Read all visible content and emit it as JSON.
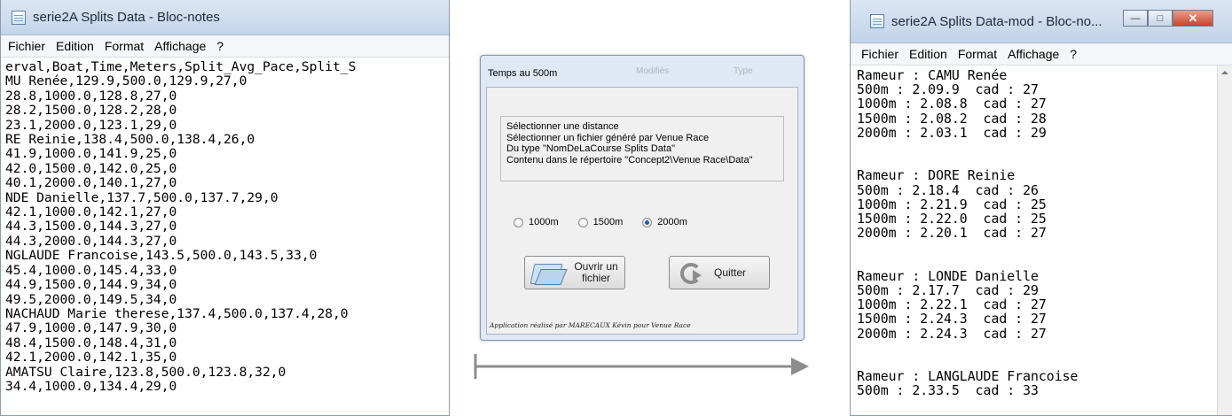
{
  "left_window": {
    "title": "serie2A Splits Data - Bloc-notes",
    "menu": [
      "Fichier",
      "Edition",
      "Format",
      "Affichage",
      "?"
    ],
    "lines": [
      "erval,Boat,Time,Meters,Split_Avg_Pace,Split_S",
      "MU Renée,129.9,500.0,129.9,27,0",
      "28.8,1000.0,128.8,27,0",
      "28.2,1500.0,128.2,28,0",
      "23.1,2000.0,123.1,29,0",
      "RE Reinie,138.4,500.0,138.4,26,0",
      "41.9,1000.0,141.9,25,0",
      "42.0,1500.0,142.0,25,0",
      "40.1,2000.0,140.1,27,0",
      "NDE Danielle,137.7,500.0,137.7,29,0",
      "42.1,1000.0,142.1,27,0",
      "44.3,1500.0,144.3,27,0",
      "44.3,2000.0,144.3,27,0",
      "NGLAUDE Francoise,143.5,500.0,143.5,33,0",
      "45.4,1000.0,145.4,33,0",
      "44.9,1500.0,144.9,34,0",
      "49.5,2000.0,149.5,34,0",
      "NACHAUD Marie therese,137.4,500.0,137.4,28,0",
      "47.9,1000.0,147.9,30,0",
      "48.4,1500.0,148.4,31,0",
      "42.1,2000.0,142.1,35,0",
      "AMATSU Claire,123.8,500.0,123.8,32,0",
      "34.4,1000.0,134.4,29,0"
    ]
  },
  "dialog": {
    "title": "Temps au 500m",
    "ghost_left": "Modifiés",
    "ghost_right": "Type",
    "info": [
      "Sélectionner une distance",
      "Sélectionner un fichier généré par Venue Race",
      "Du type \"NomDeLaCourse Splits Data\"",
      "Contenu dans le répertoire \"Concept2\\Venue Race\\Data\""
    ],
    "radios": [
      {
        "label": "1000m",
        "checked": false
      },
      {
        "label": "1500m",
        "checked": false
      },
      {
        "label": "2000m",
        "checked": true
      }
    ],
    "open_button_line1": "Ouvrir un",
    "open_button_line2": "fichier",
    "quit_button": "Quitter",
    "footnote": "Application réalisé par MARECAUX Kévin pour Venue Race"
  },
  "right_window": {
    "title": "serie2A Splits Data-mod - Bloc-no...",
    "menu": [
      "Fichier",
      "Edition",
      "Format",
      "Affichage",
      "?"
    ],
    "lines": [
      "Rameur : CAMU Renée",
      "500m : 2.09.9  cad : 27",
      "1000m : 2.08.8  cad : 27",
      "1500m : 2.08.2  cad : 28",
      "2000m : 2.03.1  cad : 29",
      "",
      "",
      "Rameur : DORE Reinie",
      "500m : 2.18.4  cad : 26",
      "1000m : 2.21.9  cad : 25",
      "1500m : 2.22.0  cad : 25",
      "2000m : 2.20.1  cad : 27",
      "",
      "",
      "Rameur : LONDE Danielle",
      "500m : 2.17.7  cad : 29",
      "1000m : 2.22.1  cad : 27",
      "1500m : 2.24.3  cad : 27",
      "2000m : 2.24.3  cad : 27",
      "",
      "",
      "Rameur : LANGLAUDE Francoise",
      "500m : 2.33.5  cad : 33"
    ]
  },
  "colors": {
    "titlebar": "#c9d8ec",
    "close_button": "#c8452b",
    "radio_selected": "#1b5fc1",
    "arrow": "#8c8c8c"
  },
  "icons": [
    "notepad-icon",
    "folder-open-icon",
    "quit-arrow-icon",
    "minimize-icon",
    "maximize-icon",
    "close-icon"
  ]
}
